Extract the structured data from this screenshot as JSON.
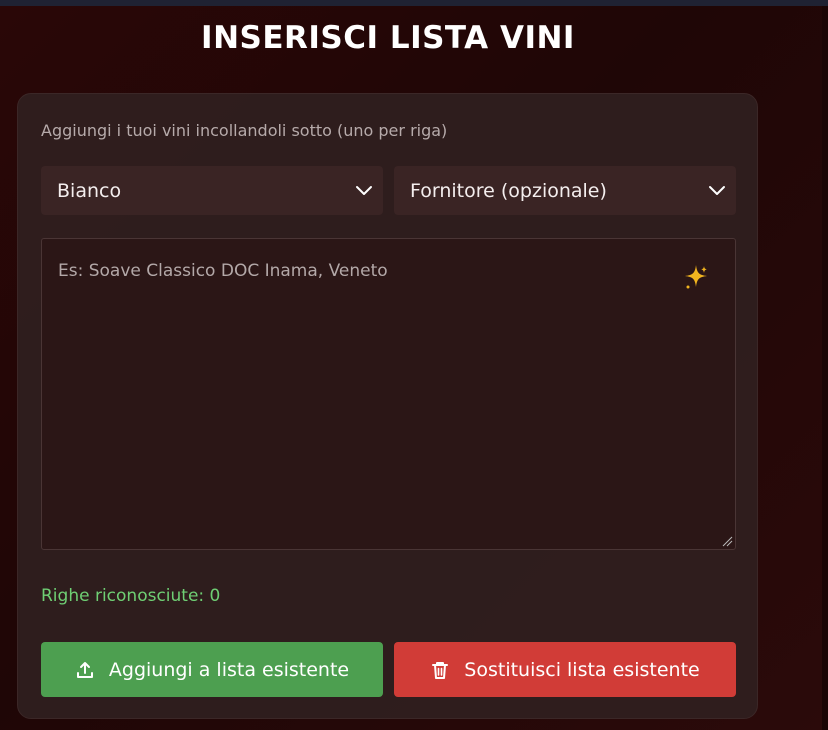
{
  "header": {
    "title": "INSERISCI LISTA VINI"
  },
  "form": {
    "hint": "Aggiungi i tuoi vini incollandoli sotto (uno per riga)",
    "type_select": {
      "value": "Bianco"
    },
    "supplier_select": {
      "value": "Fornitore (opzionale)"
    },
    "textarea": {
      "placeholder": "Es: Soave Classico DOC Inama, Veneto"
    },
    "recognized": "Righe riconosciute: 0",
    "buttons": {
      "add": "Aggiungi a lista esistente",
      "replace": "Sostituisci lista esistente"
    }
  },
  "colors": {
    "background": "#240707",
    "card": "#302020",
    "add_button": "#4d9f50",
    "replace_button": "#d13c37",
    "count_text": "#6fcf74",
    "sparkle": "#f2b51f"
  },
  "icons": [
    "chevron-down-icon",
    "sparkle-icon",
    "upload-icon",
    "trash-icon",
    "resize-handle-icon"
  ]
}
